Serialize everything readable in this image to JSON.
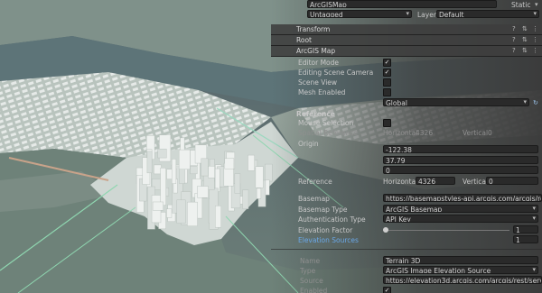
{
  "object": {
    "name": "ArcGISMap",
    "static_label": "Static",
    "tag": "Untagged",
    "layer_label": "Layer",
    "layer_value": "Default"
  },
  "components": {
    "transform": "Transform",
    "root": "Root",
    "map": "ArcGIS Map"
  },
  "map_settings": {
    "mode_label": "Editor Mode",
    "mode_checked": true,
    "camera_label": "Editing Scene Camera",
    "camera_checked": true,
    "sceneview_label": "Scene View",
    "sceneview_checked": false,
    "enabled_label": "Mesh Enabled",
    "enabled_checked": false,
    "view_mode": "Global",
    "reference_label": "Reference",
    "selection_label": "Mouse Selection",
    "selection_checked": false,
    "sr_label": "Spatial Reference",
    "horizontal_label": "Horizontal",
    "horizontal_value": "4326",
    "vertical_label": "Vertical",
    "vertical_value": "0",
    "origin_label": "Origin",
    "origin_x": "-122.38",
    "origin_y": "37.79",
    "origin_z": "0",
    "reference2_label": "Reference",
    "horizontal2_value": "4326",
    "vertical2_value": "0"
  },
  "basemap": {
    "label": "Basemap",
    "url": "https://basemapstyles-api.arcgis.com/arcgis/rest/services",
    "type_label": "Basemap Type",
    "type_value": "ArcGIS Basemap",
    "auth_label": "Authentication Type",
    "auth_value": "API Key",
    "exag_label": "Elevation Factor",
    "exag_value": "1"
  },
  "elevation": {
    "sources_label": "Elevation Sources",
    "sources_count": "1",
    "name_label": "Name",
    "name_value": "Terrain 3D",
    "type_label": "Type",
    "type_value": "ArcGIS Image Elevation Source",
    "source_label": "Source",
    "source_value": "https://elevation3d.arcgis.com/arcgis/rest/services/Wo",
    "enabled_label": "Enabled",
    "enabled_checked": true
  },
  "icons": [
    "help-icon",
    "settings-icon",
    "menu-icon",
    "checkmark-icon",
    "dropdown-icon",
    "refresh-icon"
  ],
  "colors": {
    "panel": "#3c3c3c",
    "accent_blue": "#6aa8e8",
    "water": "#4e6c72",
    "buildings": "#e4e8e6"
  }
}
